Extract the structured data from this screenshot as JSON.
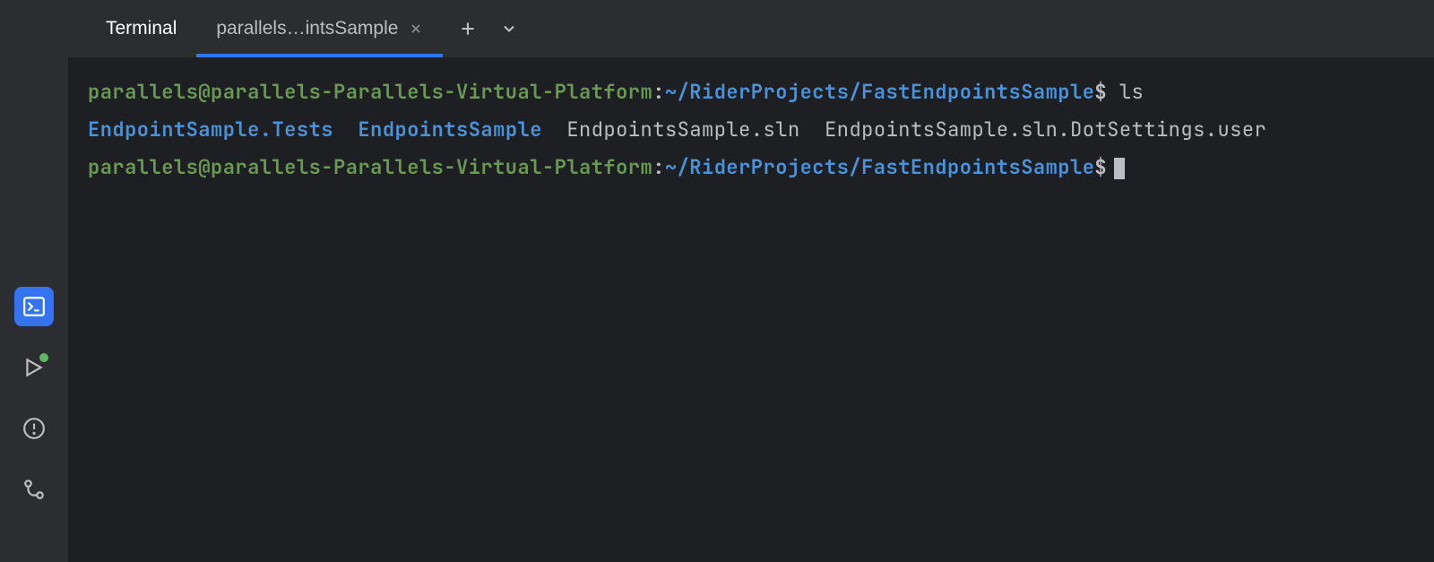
{
  "colors": {
    "accent": "#3574f0",
    "promptUser": "#6a9955",
    "promptPath": "#4a92d9",
    "bg": "#1e1f22",
    "panelBg": "#2b2d30"
  },
  "sidebar": {
    "items": [
      {
        "name": "terminal-icon",
        "active": true
      },
      {
        "name": "run-icon",
        "active": false
      },
      {
        "name": "problems-icon",
        "active": false
      },
      {
        "name": "git-icon",
        "active": false
      }
    ]
  },
  "tabbar": {
    "mainLabel": "Terminal",
    "sessionTab": {
      "label": "parallels…intsSample"
    }
  },
  "terminal": {
    "prompt": {
      "userHost": "parallels@parallels-Parallels-Virtual-Platform",
      "sep": ":",
      "path": "~/RiderProjects/FastEndpointsSample",
      "symbol": "$"
    },
    "line1": {
      "command": "ls"
    },
    "lsOutput": {
      "dirs": [
        "EndpointSample.Tests",
        "EndpointsSample"
      ],
      "files": [
        "EndpointsSample.sln",
        "EndpointsSample.sln.DotSettings.user"
      ]
    }
  }
}
